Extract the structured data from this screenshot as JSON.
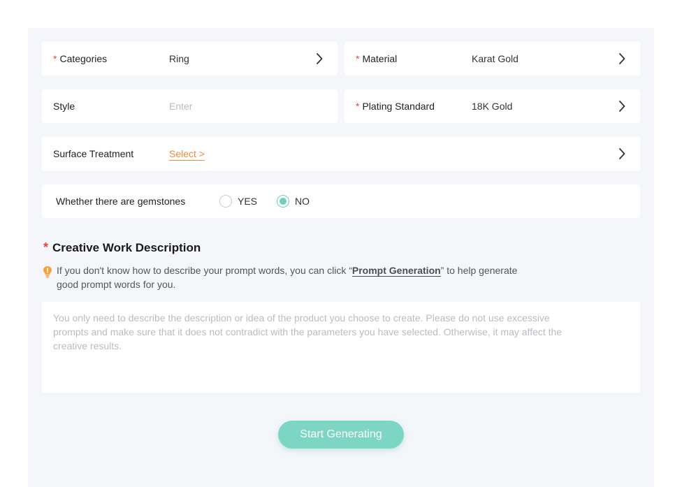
{
  "colors": {
    "required": "#e5463a",
    "accent": "#6fcfb9",
    "link_orange": "#f08a3c",
    "button": "#7dd6c3",
    "panel_bg": "#f4f6fa"
  },
  "fields": {
    "categories": {
      "required": "*",
      "label": "Categories",
      "value": "Ring"
    },
    "material": {
      "required": "*",
      "label": "Material",
      "value": "Karat Gold"
    },
    "style": {
      "label": "Style",
      "placeholder": "Enter"
    },
    "plating": {
      "required": "*",
      "label": "Plating Standard",
      "value": "18K Gold"
    },
    "surface": {
      "label": "Surface Treatment",
      "value": "Select >"
    }
  },
  "gemstones": {
    "label": "Whether there are gemstones",
    "options": [
      {
        "label": "YES",
        "checked": false
      },
      {
        "label": "NO",
        "checked": true
      }
    ]
  },
  "description": {
    "required": "*",
    "title": "Creative Work Description",
    "hint_before": "If you don't know how to describe your prompt words, you can click “",
    "hint_link": "Prompt Generation",
    "hint_after": "” to help generate good prompt words for you.",
    "placeholder": "You only need to describe the description or idea of the product you choose to create. Please do not use excessive prompts and make sure that it does not contradict with the parameters you have selected. Otherwise, it may affect the creative results.",
    "value": ""
  },
  "actions": {
    "generate_label": "Start Generating"
  },
  "icons": {
    "chevron": "chevron-right-icon",
    "hint": "lightbulb-icon"
  }
}
